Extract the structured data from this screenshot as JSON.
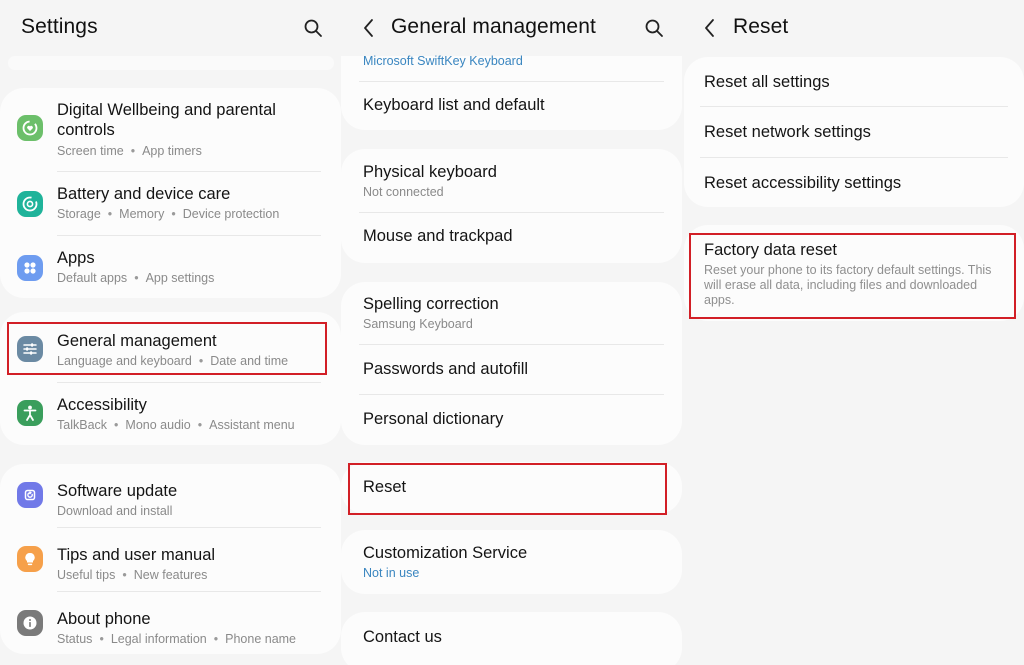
{
  "settings_panel": {
    "title": "Settings",
    "items": [
      {
        "title_line1": "Digital Wellbeing and parental",
        "title_line2": "controls",
        "subtitle": [
          "Screen time",
          "App timers"
        ],
        "icon": "digital-wellbeing-icon",
        "icon_color": "#6cbf6a"
      },
      {
        "title": "Battery and device care",
        "subtitle": [
          "Storage",
          "Memory",
          "Device protection"
        ],
        "icon": "device-care-icon",
        "icon_color": "#1fb39a"
      },
      {
        "title": "Apps",
        "subtitle": [
          "Default apps",
          "App settings"
        ],
        "icon": "apps-icon",
        "icon_color": "#6e9cf0"
      },
      {
        "title": "General management",
        "subtitle": [
          "Language and keyboard",
          "Date and time"
        ],
        "icon": "general-management-icon",
        "icon_color": "#6b8aa3",
        "highlighted": true
      },
      {
        "title": "Accessibility",
        "subtitle": [
          "TalkBack",
          "Mono audio",
          "Assistant menu"
        ],
        "icon": "accessibility-icon",
        "icon_color": "#3a9e5c"
      },
      {
        "title": "Software update",
        "subtitle": [
          "Download and install"
        ],
        "icon": "software-update-icon",
        "icon_color": "#7179e8"
      },
      {
        "title": "Tips and user manual",
        "subtitle": [
          "Useful tips",
          "New features"
        ],
        "icon": "tips-icon",
        "icon_color": "#f6a04a"
      },
      {
        "title": "About phone",
        "subtitle": [
          "Status",
          "Legal information",
          "Phone name"
        ],
        "icon": "about-phone-icon",
        "icon_color": "#7a7a7a"
      }
    ]
  },
  "general_panel": {
    "title": "General management",
    "items": [
      {
        "title": "",
        "subtitle": "Microsoft SwiftKey Keyboard",
        "subtitle_color": "blue"
      },
      {
        "title": "Keyboard list and default"
      },
      {
        "title": "Physical keyboard",
        "subtitle": "Not connected"
      },
      {
        "title": "Mouse and trackpad"
      },
      {
        "title": "Spelling correction",
        "subtitle": "Samsung Keyboard"
      },
      {
        "title": "Passwords and autofill"
      },
      {
        "title": "Personal dictionary"
      },
      {
        "title": "Reset",
        "highlighted": true
      },
      {
        "title": "Customization Service",
        "subtitle": "Not in use",
        "subtitle_color": "blue"
      },
      {
        "title": "Contact us"
      }
    ]
  },
  "reset_panel": {
    "title": "Reset",
    "items": [
      {
        "title": "Reset all settings"
      },
      {
        "title": "Reset network settings"
      },
      {
        "title": "Reset accessibility settings"
      },
      {
        "title": "Factory data reset",
        "description": "Reset your phone to its factory default settings. This will erase all data, including files and downloaded apps.",
        "highlighted": true
      }
    ]
  },
  "colors": {
    "background": "#f5f5f5",
    "card": "#fcfcfc",
    "highlight": "#d21f26",
    "link_blue": "#3a86c0",
    "subtitle_gray": "#8a8a8a"
  }
}
